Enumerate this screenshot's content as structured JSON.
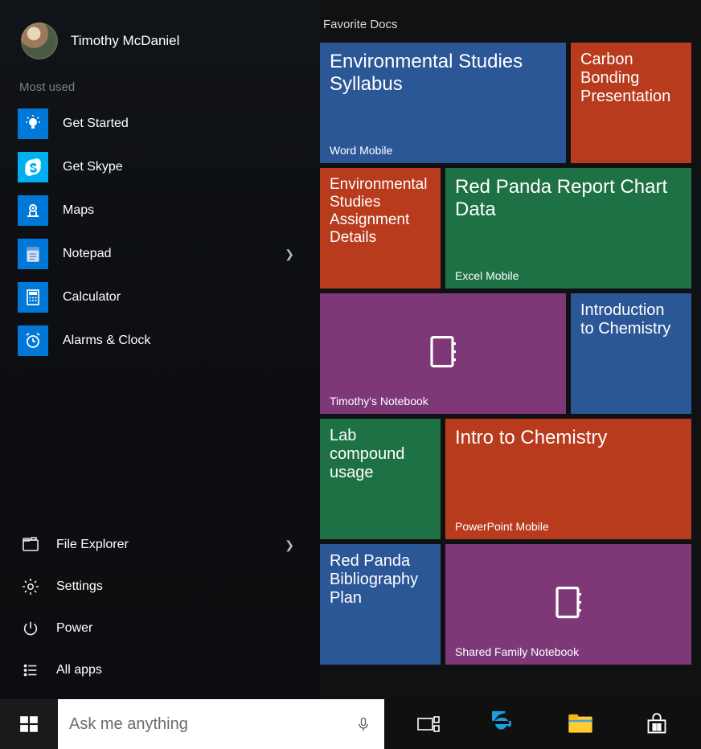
{
  "user": {
    "name": "Timothy McDaniel"
  },
  "sections": {
    "most_used": "Most used"
  },
  "apps": [
    {
      "label": "Get Started"
    },
    {
      "label": "Get Skype"
    },
    {
      "label": "Maps"
    },
    {
      "label": "Notepad",
      "has_submenu": true
    },
    {
      "label": "Calculator"
    },
    {
      "label": "Alarms & Clock"
    }
  ],
  "bottom": [
    {
      "label": "File Explorer",
      "has_submenu": true
    },
    {
      "label": "Settings"
    },
    {
      "label": "Power"
    },
    {
      "label": "All apps"
    }
  ],
  "tiles": {
    "group_title": "Favorite Docs",
    "items": [
      {
        "title": "Environmental Studies Syllabus",
        "app": "Word Mobile"
      },
      {
        "title": "Carbon Bonding Presentation"
      },
      {
        "title": "Environmental Studies Assignment Details"
      },
      {
        "title": "Red Panda Report Chart Data",
        "app": "Excel Mobile"
      },
      {
        "title": "",
        "app": "Timothy's Notebook"
      },
      {
        "title": "Introduction to Chemistry"
      },
      {
        "title": "Lab compound usage"
      },
      {
        "title": "Intro to Chemistry",
        "app": "PowerPoint Mobile"
      },
      {
        "title": "Red Panda Bibliography Plan"
      },
      {
        "title": "",
        "app": "Shared Family Notebook"
      }
    ]
  },
  "taskbar": {
    "search_placeholder": "Ask me anything"
  }
}
